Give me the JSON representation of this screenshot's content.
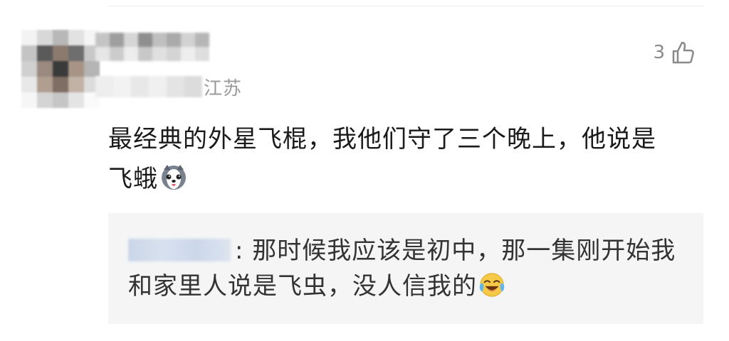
{
  "comment": {
    "avatar": "blurred-avatar",
    "username": "",
    "location": "江苏",
    "like_count": "3",
    "like_icon": "thumbs-up-icon",
    "text": "最经典的外星飞棍，我他们守了三个晚上，他说是飞蛾",
    "emoji": "husky-dog-emoji"
  },
  "reply": {
    "author": "",
    "separator": ":",
    "text": " 那时候我应该是初中，那一集刚开始我和家里人说是飞虫，没人信我的",
    "emoji": "laughing-crying-emoji"
  },
  "colors": {
    "text": "#1a1a1a",
    "meta": "#9a9a9a",
    "reply_bg": "#f5f5f5"
  }
}
